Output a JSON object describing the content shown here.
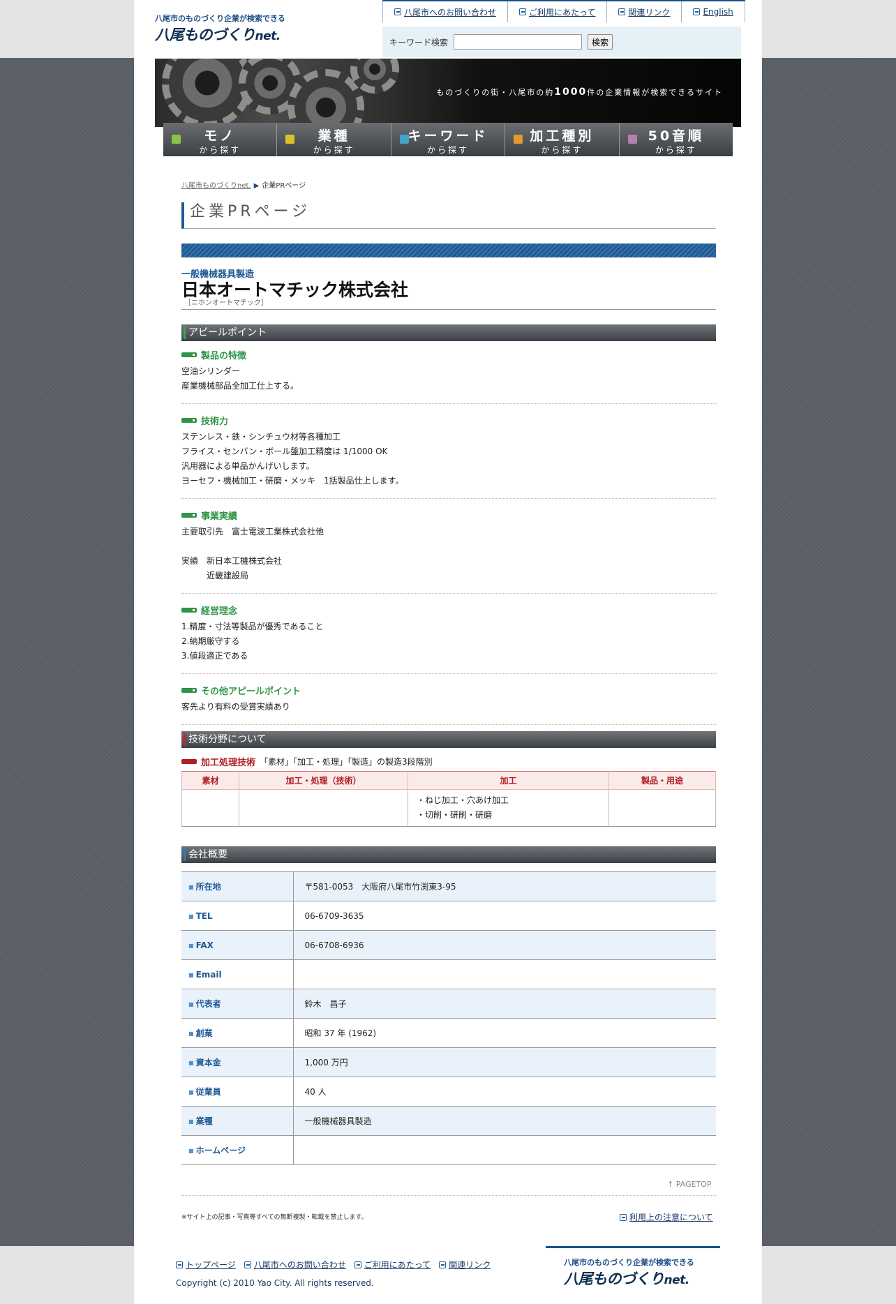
{
  "header": {
    "tagline": "八尾市のものづくり企業が検索できる",
    "logo_main": "八尾ものづくり",
    "logo_net": "net.",
    "nav": [
      "八尾市へのお問い合わせ",
      "ご利用にあたって",
      "関連リンク",
      "English"
    ],
    "search_label": "キーワード検索",
    "search_value": "",
    "search_button": "検索"
  },
  "hero": {
    "text_before": "ものづくりの街・八尾市の約",
    "text_bold": "1000",
    "text_after": "件の企業情報が検索できるサイト"
  },
  "mainnav": [
    {
      "big": "モノ",
      "small": "から探す",
      "color": "#8bc34a"
    },
    {
      "big": "業種",
      "small": "から探す",
      "color": "#d7c42a"
    },
    {
      "big": "キーワード",
      "small": "から探す",
      "color": "#42a5c5"
    },
    {
      "big": "加工種別",
      "small": "から探す",
      "color": "#e39a2a"
    },
    {
      "big": "50音順",
      "small": "から探す",
      "color": "#b27fb0"
    }
  ],
  "breadcrumb": {
    "home": "八尾市ものづくりnet.",
    "current": "企業PRページ"
  },
  "page_title": "企業PRページ",
  "company": {
    "category": "一般機械器具製造",
    "name": "日本オートマチック株式会社",
    "kana": "［ニホンオートマチック］"
  },
  "appeal": {
    "heading": "アピールポイント",
    "items": [
      {
        "title": "製品の特徴",
        "body": "空油シリンダー\n産業機械部品全加工仕上する。"
      },
      {
        "title": "技術力",
        "body": "ステンレス・鉄・シンチュウ材等各種加工\nフライス・センバン・ボール盤加工精度は 1/1000 OK\n汎用器による単品かんげいします。\nヨーセフ・機械加工・研磨・メッキ　1括製品仕上します。"
      },
      {
        "title": "事業実績",
        "body": "主要取引先　富士電波工業株式会社他\n\n実績　新日本工機株式会社\n　　　近畿建設局"
      },
      {
        "title": "経営理念",
        "body": "1.精度・寸法等製品が優秀であること\n2.納期厳守する\n3.値段適正である"
      },
      {
        "title": "その他アピールポイント",
        "body": "客先より有料の受賞実績あり"
      }
    ]
  },
  "tech": {
    "heading": "技術分野について",
    "sub_title": "加工処理技術",
    "sub_note": "「素材」「加工・処理」「製造」の製造3段階別",
    "columns": [
      "素材",
      "加工・処理（技術）",
      "加工",
      "製品・用途"
    ],
    "cells": [
      "",
      "",
      "・ねじ加工・穴あけ加工\n・切削・研削・研磨",
      ""
    ]
  },
  "profile": {
    "heading": "会社概要",
    "rows": [
      {
        "key": "所在地",
        "value": "〒581-0053　大阪府八尾市竹渕東3-95"
      },
      {
        "key": "TEL",
        "value": "06-6709-3635"
      },
      {
        "key": "FAX",
        "value": "06-6708-6936"
      },
      {
        "key": "Email",
        "value": ""
      },
      {
        "key": "代表者",
        "value": "鈴木　昌子"
      },
      {
        "key": "創業",
        "value": "昭和 37 年 (1962)"
      },
      {
        "key": "資本金",
        "value": "1,000 万円"
      },
      {
        "key": "従業員",
        "value": "40 人"
      },
      {
        "key": "業種",
        "value": "一般機械器具製造"
      },
      {
        "key": "ホームページ",
        "value": ""
      }
    ]
  },
  "pagetop": "PAGETOP",
  "copy_notice": "※サイト上の記事・写真等すべての無断複製・転載を禁止します。",
  "notice_link": "利用上の注意について",
  "footer": {
    "nav": [
      "トップページ",
      "八尾市へのお問い合わせ",
      "ご利用にあたって",
      "関連リンク"
    ],
    "copyright": "Copyright (c) 2010 Yao City. All rights reserved.",
    "tagline": "八尾市のものづくり企業が検索できる",
    "logo_main": "八尾ものづくり",
    "logo_net": "net."
  }
}
